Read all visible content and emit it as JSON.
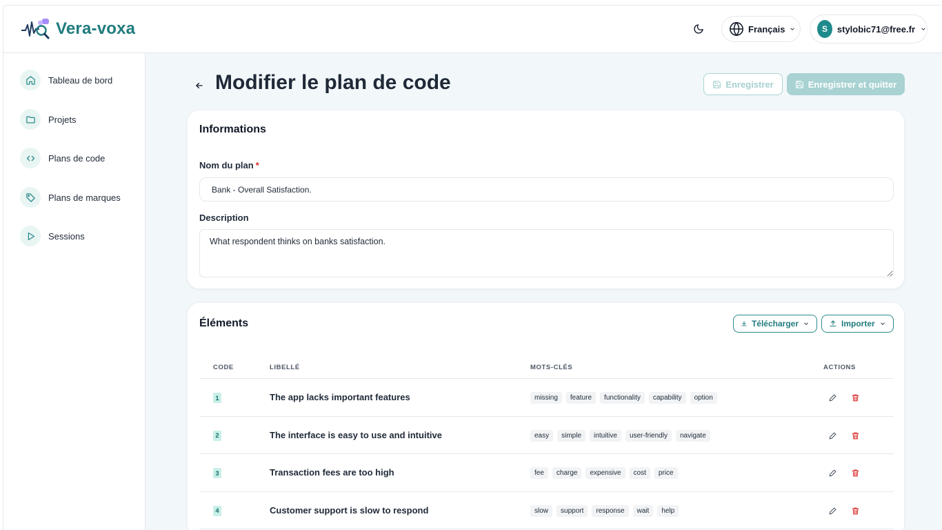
{
  "app": {
    "name": "Vera-voxa"
  },
  "header": {
    "language": "Français",
    "user": {
      "initial": "S",
      "email": "stylobic71@free.fr"
    }
  },
  "sidebar": {
    "items": [
      {
        "label": "Tableau de bord",
        "icon": "home-icon"
      },
      {
        "label": "Projets",
        "icon": "folder-icon"
      },
      {
        "label": "Plans de code",
        "icon": "code-icon"
      },
      {
        "label": "Plans de marques",
        "icon": "tag-icon"
      },
      {
        "label": "Sessions",
        "icon": "play-icon"
      }
    ]
  },
  "page": {
    "title": "Modifier le plan de code",
    "save_label": "Enregistrer",
    "save_quit_label": "Enregistrer et quitter"
  },
  "info": {
    "title": "Informations",
    "name_label": "Nom du plan",
    "required_mark": "*",
    "name_value": "Bank - Overall Satisfaction.",
    "description_label": "Description",
    "description_value": "What respondent thinks on banks satisfaction."
  },
  "elements": {
    "title": "Éléments",
    "download_label": "Télécharger",
    "import_label": "Importer",
    "columns": {
      "code": "CODE",
      "label": "LIBELLÉ",
      "keywords": "MOTS-CLÉS",
      "actions": "ACTIONS"
    },
    "rows": [
      {
        "code": "1",
        "label": "The app lacks important features",
        "keywords": [
          "missing",
          "feature",
          "functionality",
          "capability",
          "option"
        ]
      },
      {
        "code": "2",
        "label": "The interface is easy to use and intuitive",
        "keywords": [
          "easy",
          "simple",
          "intuitive",
          "user-friendly",
          "navigate"
        ]
      },
      {
        "code": "3",
        "label": "Transaction fees are too high",
        "keywords": [
          "fee",
          "charge",
          "expensive",
          "cost",
          "price"
        ]
      },
      {
        "code": "4",
        "label": "Customer support is slow to respond",
        "keywords": [
          "slow",
          "support",
          "response",
          "wait",
          "help"
        ]
      }
    ]
  },
  "colors": {
    "brand": "#1f7b7d",
    "accent_bg": "#e8f5f3",
    "danger": "#dc2626"
  }
}
